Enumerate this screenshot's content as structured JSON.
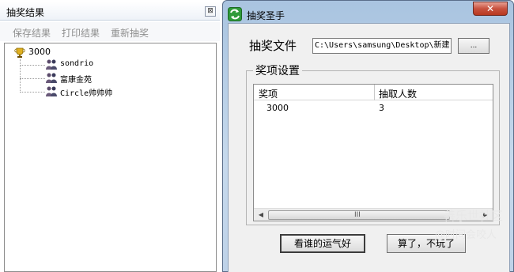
{
  "results_panel": {
    "title": "抽奖结果",
    "close_glyph": "⊠",
    "toolbar": {
      "save": "保存结果",
      "print": "打印结果",
      "redraw": "重新抽奖"
    },
    "tree": {
      "root_label": "3000",
      "root_icon": "trophy-icon",
      "children": [
        {
          "label": "sondrio",
          "icon": "people-icon"
        },
        {
          "label": "富康金苑",
          "icon": "people-icon"
        },
        {
          "label": "Circle帅帅帅",
          "icon": "people-icon"
        }
      ]
    }
  },
  "app_window": {
    "title": "抽奖圣手",
    "close_glyph": "✕",
    "file": {
      "label": "抽奖文件",
      "path": "C:\\Users\\samsung\\Desktop\\新建",
      "browse_label": "..."
    },
    "prize_group": {
      "title": "奖项设置",
      "columns": [
        "奖项",
        "抽取人数"
      ],
      "rows": [
        {
          "prize": "3000",
          "count": "3"
        }
      ],
      "scroll_left": "◀",
      "scroll_right": "▶",
      "scroll_grip": "III"
    },
    "buttons": {
      "draw": "看谁的运气好",
      "quit": "算了，不玩了"
    }
  },
  "watermark": {
    "line1": "善乐世社区",
    "line2": "@时间会咬人"
  },
  "colors": {
    "titlebar_blue": "#a9c4e0",
    "close_red": "#c8523f",
    "panel_gray": "#f0f0f0"
  }
}
